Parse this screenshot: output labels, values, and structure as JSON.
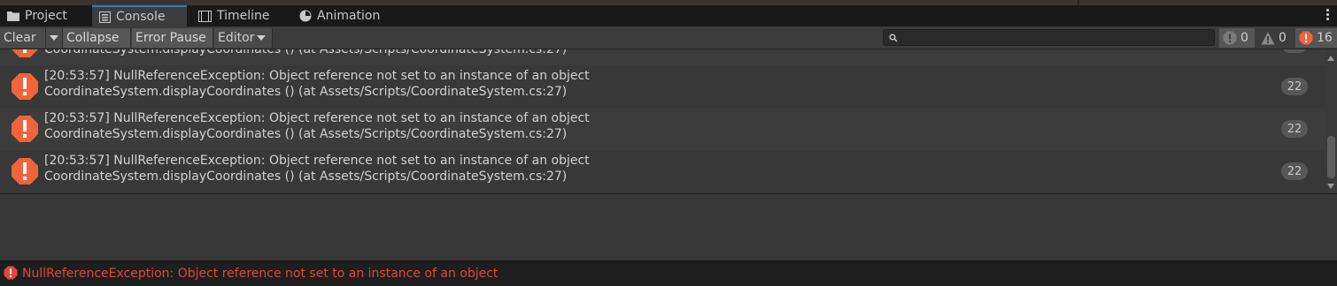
{
  "tabs": [
    {
      "label": "Project",
      "icon": "folder-icon"
    },
    {
      "label": "Console",
      "icon": "console-icon",
      "active": true
    },
    {
      "label": "Timeline",
      "icon": "timeline-icon"
    },
    {
      "label": "Animation",
      "icon": "animation-icon"
    }
  ],
  "toolbar": {
    "clear_label": "Clear",
    "collapse_label": "Collapse",
    "error_pause_label": "Error Pause",
    "editor_label": "Editor",
    "search_placeholder": "",
    "log_count": "0",
    "warning_count": "0",
    "error_count": "16"
  },
  "log_entries": [
    {
      "line1": "",
      "line2": "CoordinateSystem.displayCoordinates () (at Assets/Scripts/CoordinateSystem.cs:27)",
      "count": ""
    },
    {
      "line1": "[20:53:57] NullReferenceException: Object reference not set to an instance of an object",
      "line2": "CoordinateSystem.displayCoordinates () (at Assets/Scripts/CoordinateSystem.cs:27)",
      "count": "22"
    },
    {
      "line1": "[20:53:57] NullReferenceException: Object reference not set to an instance of an object",
      "line2": "CoordinateSystem.displayCoordinates () (at Assets/Scripts/CoordinateSystem.cs:27)",
      "count": "22"
    },
    {
      "line1": "[20:53:57] NullReferenceException: Object reference not set to an instance of an object",
      "line2": "CoordinateSystem.displayCoordinates () (at Assets/Scripts/CoordinateSystem.cs:27)",
      "count": "22"
    }
  ],
  "status": {
    "message": "NullReferenceException: Object reference not set to an instance of an object"
  },
  "colors": {
    "error": "#f0643c",
    "status_text": "#e0483c",
    "active_tab_accent": "#3a79bb"
  }
}
